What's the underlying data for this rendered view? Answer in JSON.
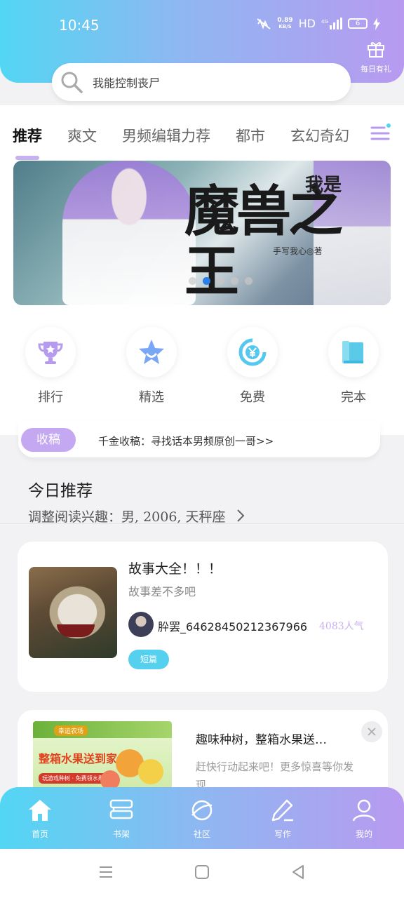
{
  "status_bar": {
    "time": "10:45",
    "net_speed_value": "0.89",
    "net_speed_unit": "KB/S",
    "hd": "HD",
    "signal": "4G",
    "battery": "6"
  },
  "header": {
    "gift_label": "每日有礼",
    "search_placeholder": "我能控制丧尸"
  },
  "tabs": [
    {
      "label": "推荐",
      "active": true
    },
    {
      "label": "爽文"
    },
    {
      "label": "男频编辑力荐"
    },
    {
      "label": "都市"
    },
    {
      "label": "玄幻奇幻"
    }
  ],
  "banner": {
    "small_title": "我是",
    "big_title": "魔兽之王",
    "author": "手写我心◎著",
    "dots": 5,
    "active_dot": 1
  },
  "quick_links": [
    {
      "label": "排行",
      "icon": "trophy-icon"
    },
    {
      "label": "精选",
      "icon": "star-icon"
    },
    {
      "label": "免费",
      "icon": "free-yen-icon"
    },
    {
      "label": "完本",
      "icon": "book-icon"
    }
  ],
  "notice": {
    "tag": "收稿",
    "text": "千金收稿：寻找话本男频原创一哥>>"
  },
  "today": {
    "title": "今日推荐",
    "subtitle": "调整阅读兴趣：男, 2006, 天秤座"
  },
  "story_card": {
    "title": "故事大全！！！",
    "desc": "故事差不多吧",
    "author": "肸罢_6462845021236796​6",
    "popularity": "4083人气",
    "tag": "短篇"
  },
  "ad_card": {
    "title": "趣味种树，整箱水果送…",
    "desc": "赶快行动起来吧！更多惊喜等你发现",
    "image_badge": "幸运农场",
    "image_text": "整箱水果送到家",
    "image_sub": "玩游戏种树 · 免费领水果"
  },
  "bottom_nav": [
    {
      "label": "首页",
      "icon": "home-icon",
      "active": true
    },
    {
      "label": "书架",
      "icon": "bookshelf-icon"
    },
    {
      "label": "社区",
      "icon": "planet-icon"
    },
    {
      "label": "写作",
      "icon": "pen-icon"
    },
    {
      "label": "我的",
      "icon": "user-icon"
    }
  ],
  "colors": {
    "gradient_start": "#52d6f3",
    "gradient_end": "#b89af0",
    "accent_purple": "#c4a8f1",
    "accent_cyan": "#56d0ef"
  }
}
